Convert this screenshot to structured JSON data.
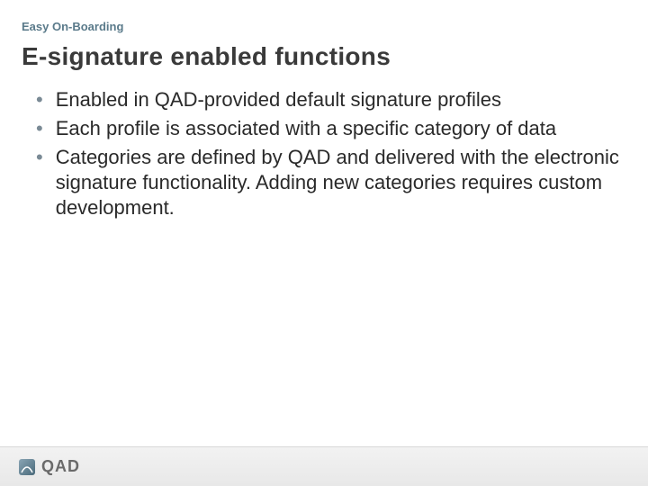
{
  "pretitle": "Easy On-Boarding",
  "title": "E-signature enabled functions",
  "bullets": [
    "Enabled in QAD-provided default signature profiles",
    "Each profile is associated with a specific category of data",
    "Categories are defined by QAD and delivered with the electronic signature functionality. Adding new categories requires custom development."
  ],
  "logo_text": "QAD",
  "bullet_char": "•"
}
